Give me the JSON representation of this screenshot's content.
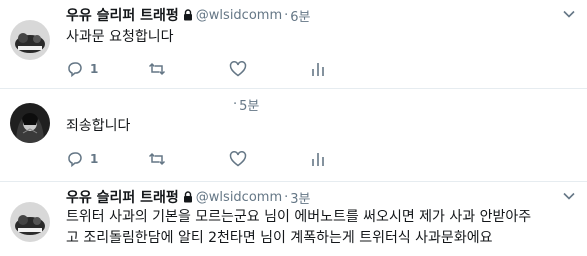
{
  "tweets": [
    {
      "name": "우유 슬리퍼 트래펑",
      "handle": "@wlsidcomm",
      "separator": "·",
      "time": "6분",
      "text": "사과문 요청합니다",
      "reply_count": "1",
      "icons": [
        "reply-icon",
        "retweet-icon",
        "like-icon",
        "analytics-icon"
      ]
    },
    {
      "name": "",
      "handle": "",
      "separator": "·",
      "time": "5분",
      "text": "죄송합니다",
      "reply_count": "1",
      "icons": [
        "reply-icon",
        "retweet-icon",
        "like-icon",
        "analytics-icon"
      ]
    },
    {
      "name": "우유 슬리퍼 트래펑",
      "handle": "@wlsidcomm",
      "separator": "·",
      "time": "3분",
      "text_line1": "트위터 사과의 기본을 모르는군요 님이 에버노트를 써오시면 제가 사과 안받아주",
      "text_line2": "고 조리돌림한담에 알티 2천타면 님이 계폭하는게 트위터식 사과문화에요",
      "icons": [
        "chevron-down-icon"
      ]
    }
  ],
  "colors": {
    "secondary_text": "#657786",
    "divider": "#e6ecf0",
    "icon": "#657786"
  }
}
